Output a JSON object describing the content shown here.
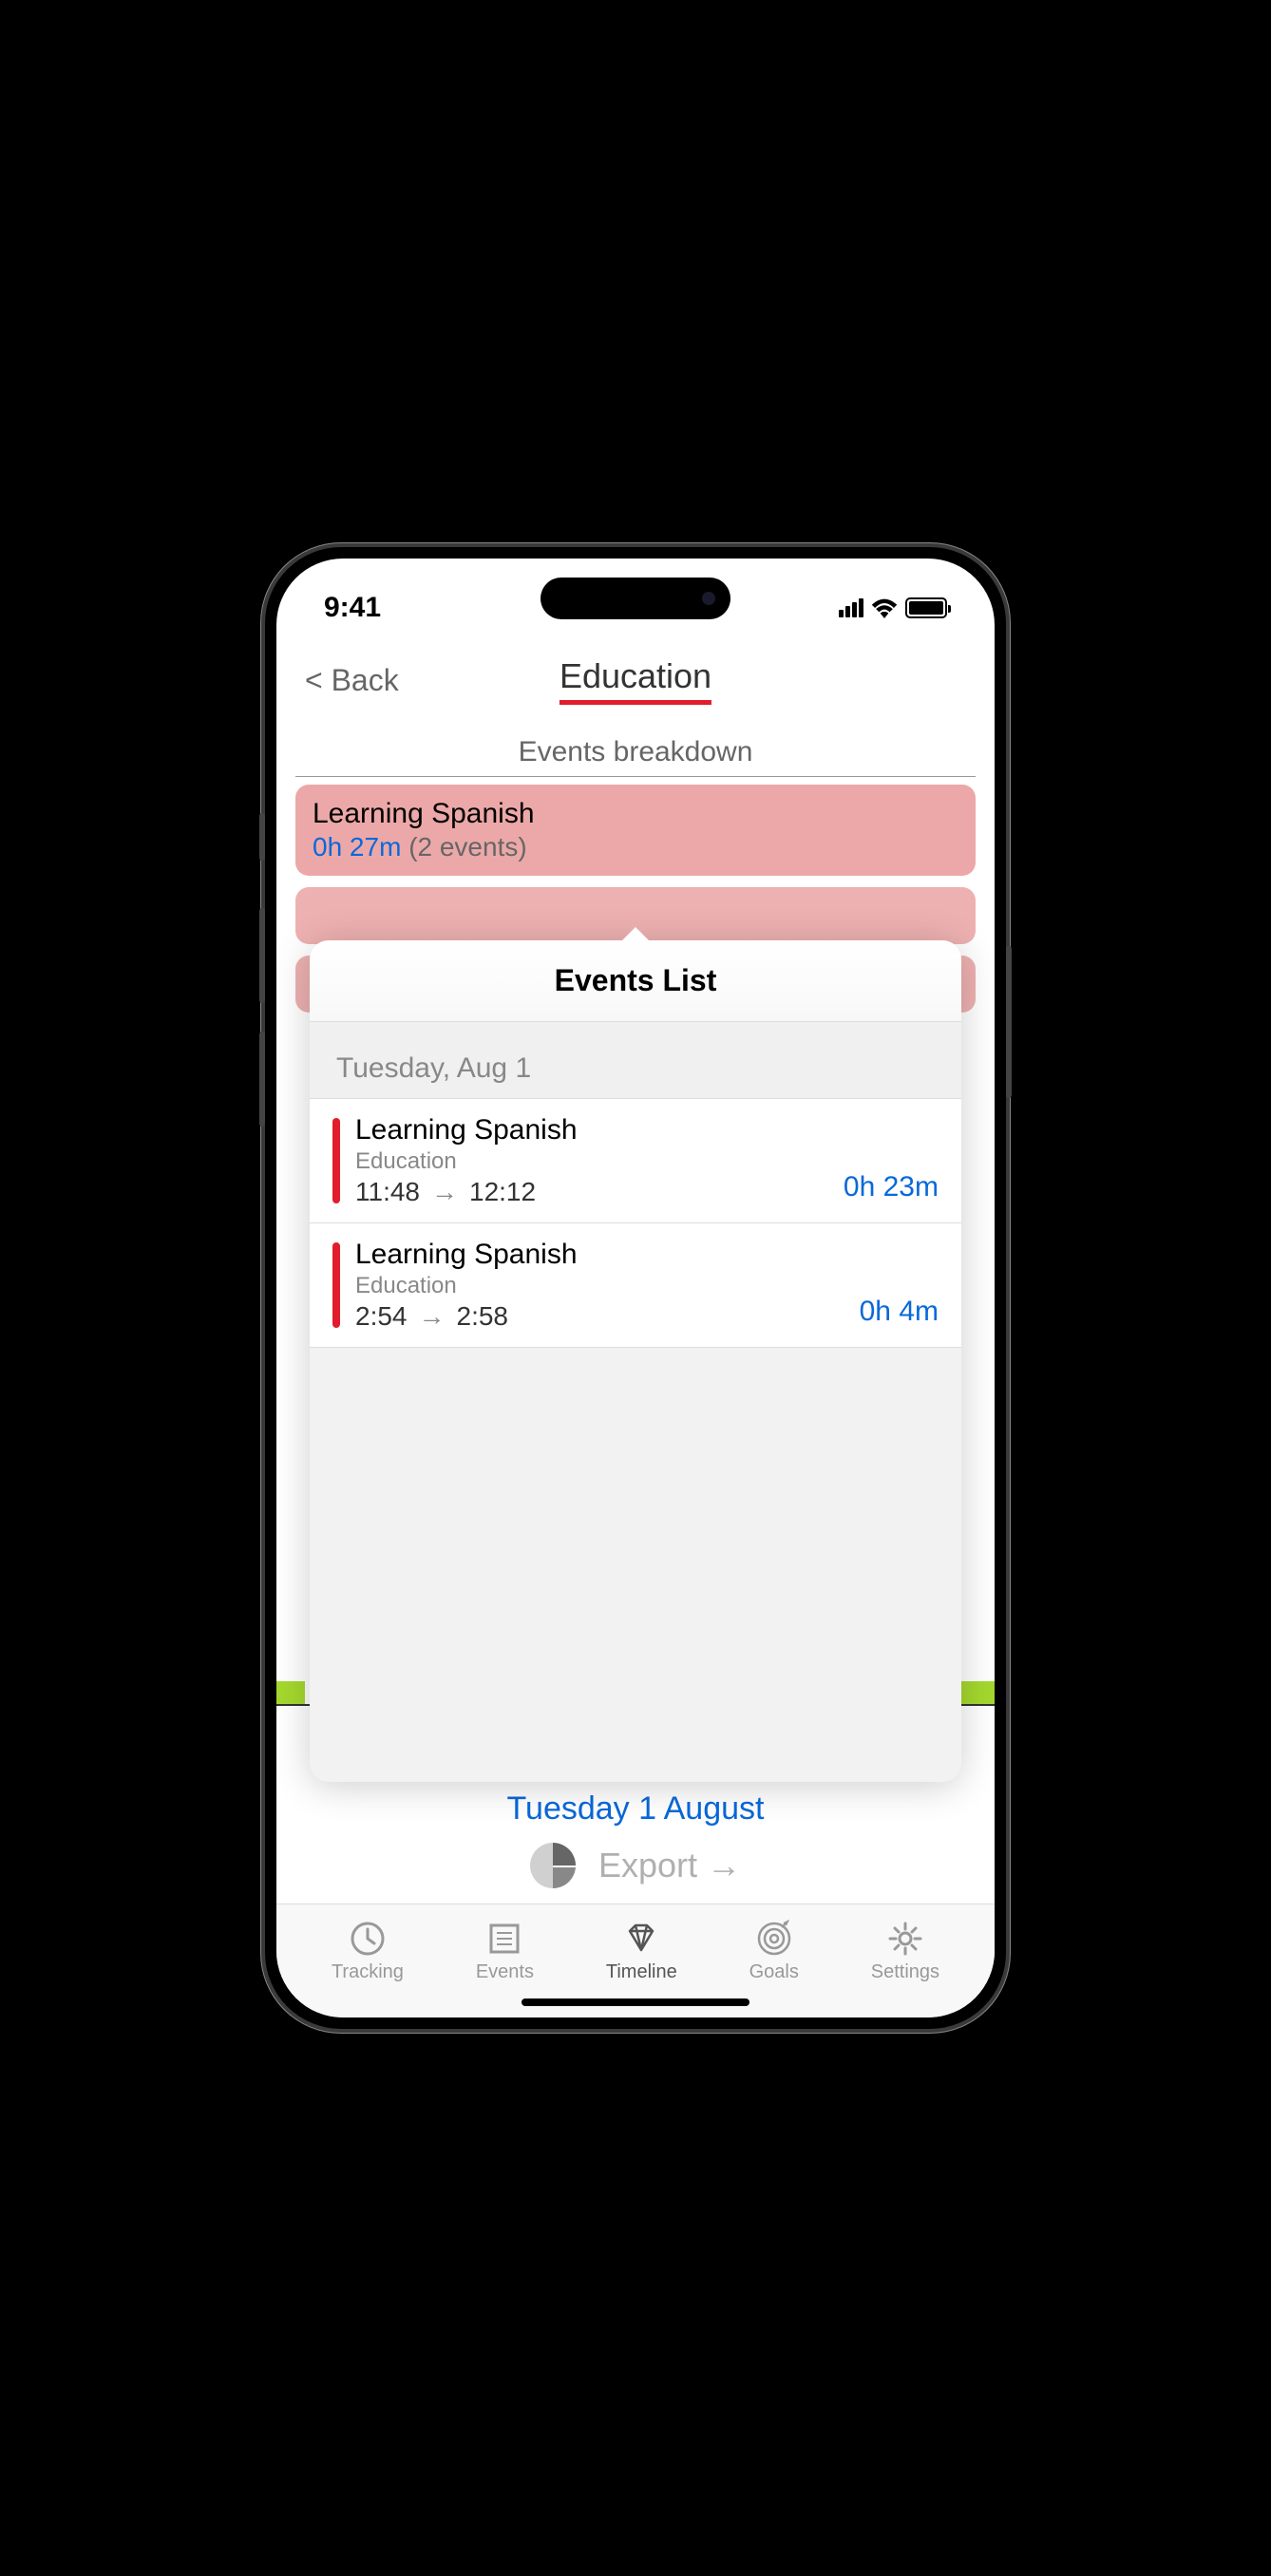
{
  "status": {
    "time": "9:41"
  },
  "nav": {
    "back": "< Back",
    "title": "Education"
  },
  "section": {
    "title": "Events breakdown"
  },
  "breakdown_card": {
    "title": "Learning Spanish",
    "duration": "0h 27m",
    "count": "(2 events)"
  },
  "popover": {
    "title": "Events List",
    "date": "Tuesday, Aug 1",
    "events": [
      {
        "title": "Learning Spanish",
        "category": "Education",
        "start": "11:48",
        "end": "12:12",
        "duration": "0h 23m"
      },
      {
        "title": "Learning Spanish",
        "category": "Education",
        "start": "2:54",
        "end": "2:58",
        "duration": "0h 4m"
      }
    ]
  },
  "timeline": {
    "date_label": "Tuesday 1 August"
  },
  "export": {
    "label": "Export →"
  },
  "tabs": [
    {
      "label": "Tracking"
    },
    {
      "label": "Events"
    },
    {
      "label": "Timeline"
    },
    {
      "label": "Goals"
    },
    {
      "label": "Settings"
    }
  ]
}
